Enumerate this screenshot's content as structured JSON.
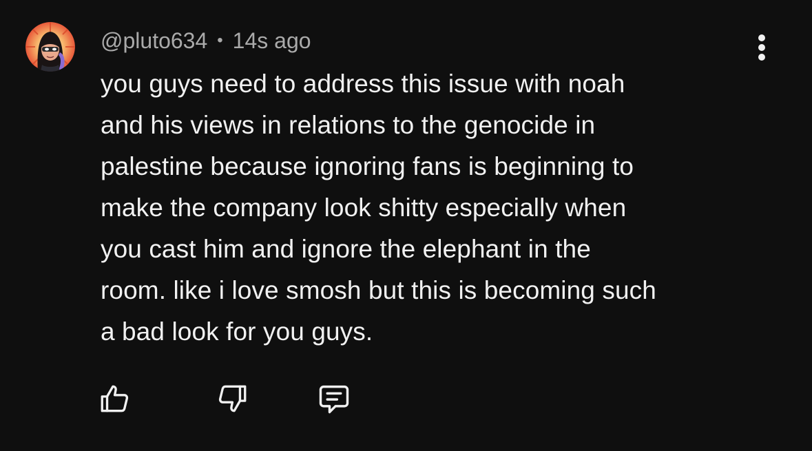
{
  "comment": {
    "author": "@pluto634",
    "separator": "•",
    "timestamp": "14s ago",
    "text": "you guys need to address this issue with noah\nand his views in relations to the genocide in\npalestine because ignoring fans is beginning to\nmake the company look shitty especially when\nyou cast him and ignore the elephant in the\nroom. like i love smosh but this is becoming such\na bad look for you guys.",
    "avatar_icon": "profile-avatar",
    "actions": [
      {
        "icon": "thumbs-up-icon"
      },
      {
        "icon": "thumbs-down-icon"
      },
      {
        "icon": "reply-icon"
      }
    ],
    "menu_icon": "more-vertical-icon"
  },
  "colors": {
    "background": "#0f0f0f",
    "text_primary": "#f1f1f1",
    "text_secondary": "#aaaaaa"
  }
}
